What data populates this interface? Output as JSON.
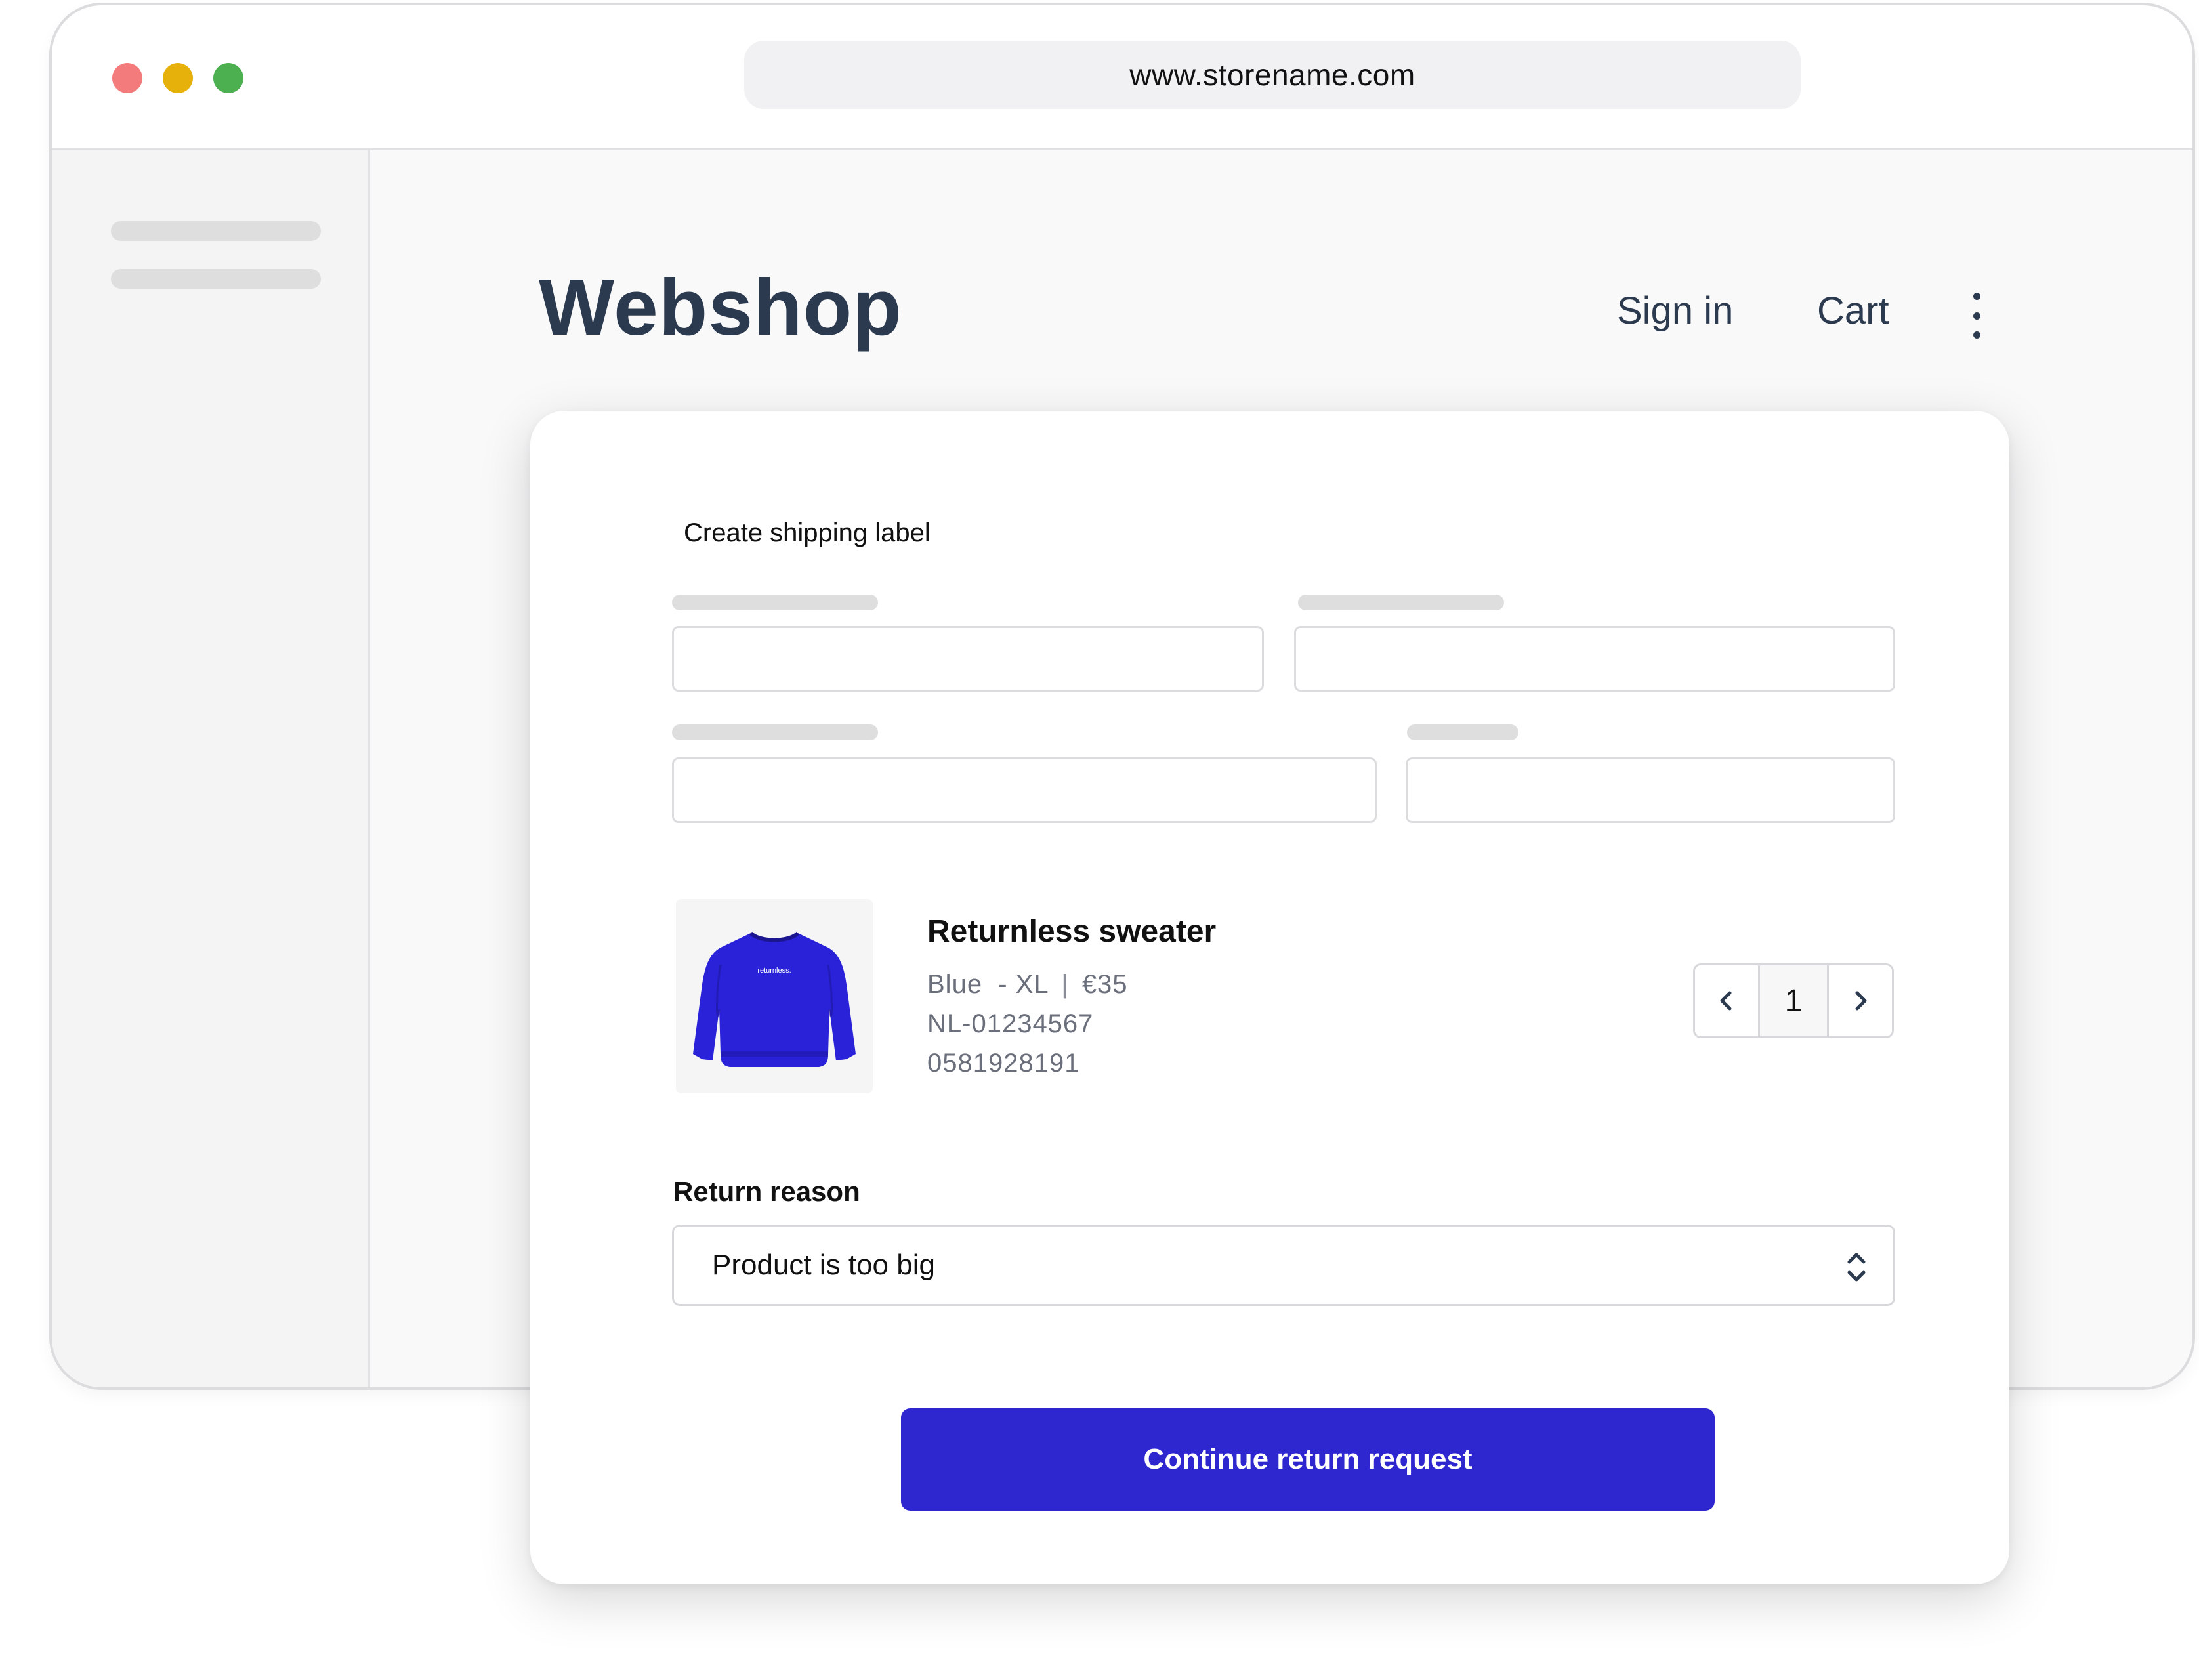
{
  "browser": {
    "url": "www.storename.com",
    "dots": {
      "red": "#f47b7b",
      "yellow": "#e6b10b",
      "green": "#4caf50"
    }
  },
  "header": {
    "brand": "Webshop",
    "sign_in": "Sign in",
    "cart": "Cart"
  },
  "form": {
    "title": "Create shipping label"
  },
  "product": {
    "name": "Returnless sweater",
    "variant": "Blue  - XL",
    "price": "€35",
    "sku": "NL-01234567",
    "ean": "0581928191",
    "quantity": "1",
    "image_label": "returnless."
  },
  "return_reason": {
    "label": "Return reason",
    "selected": "Product is too big"
  },
  "cta": {
    "label": "Continue return request"
  },
  "colors": {
    "brand_text": "#2c3a4f",
    "accent": "#2e27d0",
    "sweater": "#2a22d8"
  }
}
